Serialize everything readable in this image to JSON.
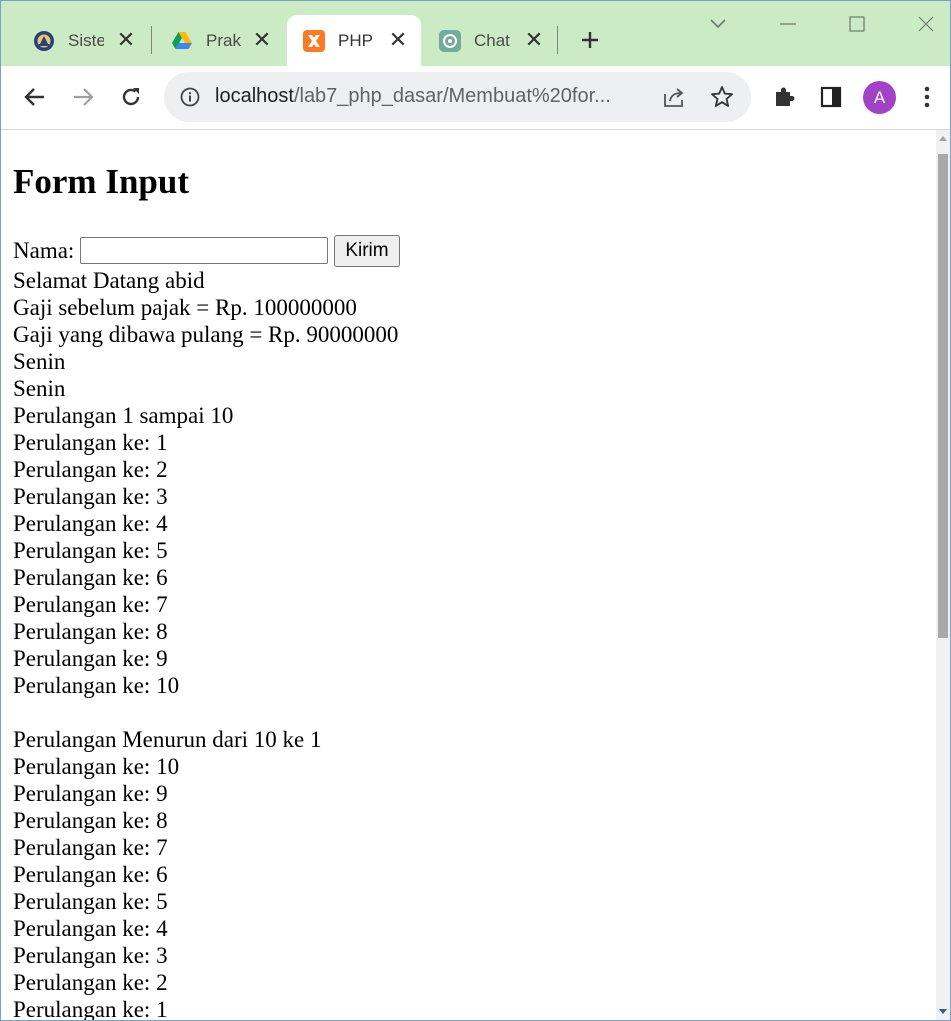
{
  "browser": {
    "tabs": [
      {
        "title": "Siste",
        "icon": "university-seal-icon",
        "active": false
      },
      {
        "title": "Prak",
        "icon": "google-drive-icon",
        "active": false
      },
      {
        "title": "PHP",
        "icon": "xampp-icon",
        "active": true
      },
      {
        "title": "Chat",
        "icon": "chatgpt-icon",
        "active": false
      }
    ],
    "url_host": "localhost",
    "url_path": "/lab7_php_dasar/Membuat%20for...",
    "profile_initial": "A",
    "colors": {
      "tabstrip": "#cbebc4",
      "avatar": "#a142c7",
      "xampp": "#fb7a24"
    }
  },
  "page": {
    "heading": "Form Input",
    "form": {
      "label": "Nama:",
      "input_value": "",
      "submit_label": "Kirim"
    },
    "output_lines": [
      "Selamat Datang abid",
      "Gaji sebelum pajak = Rp. 100000000",
      "Gaji yang dibawa pulang = Rp. 90000000",
      "Senin",
      "Senin",
      "Perulangan 1 sampai 10",
      "Perulangan ke: 1",
      "Perulangan ke: 2",
      "Perulangan ke: 3",
      "Perulangan ke: 4",
      "Perulangan ke: 5",
      "Perulangan ke: 6",
      "Perulangan ke: 7",
      "Perulangan ke: 8",
      "Perulangan ke: 9",
      "Perulangan ke: 10",
      "",
      "Perulangan Menurun dari 10 ke 1",
      "Perulangan ke: 10",
      "Perulangan ke: 9",
      "Perulangan ke: 8",
      "Perulangan ke: 7",
      "Perulangan ke: 6",
      "Perulangan ke: 5",
      "Perulangan ke: 4",
      "Perulangan ke: 3",
      "Perulangan ke: 2",
      "Perulangan ke: 1"
    ]
  }
}
